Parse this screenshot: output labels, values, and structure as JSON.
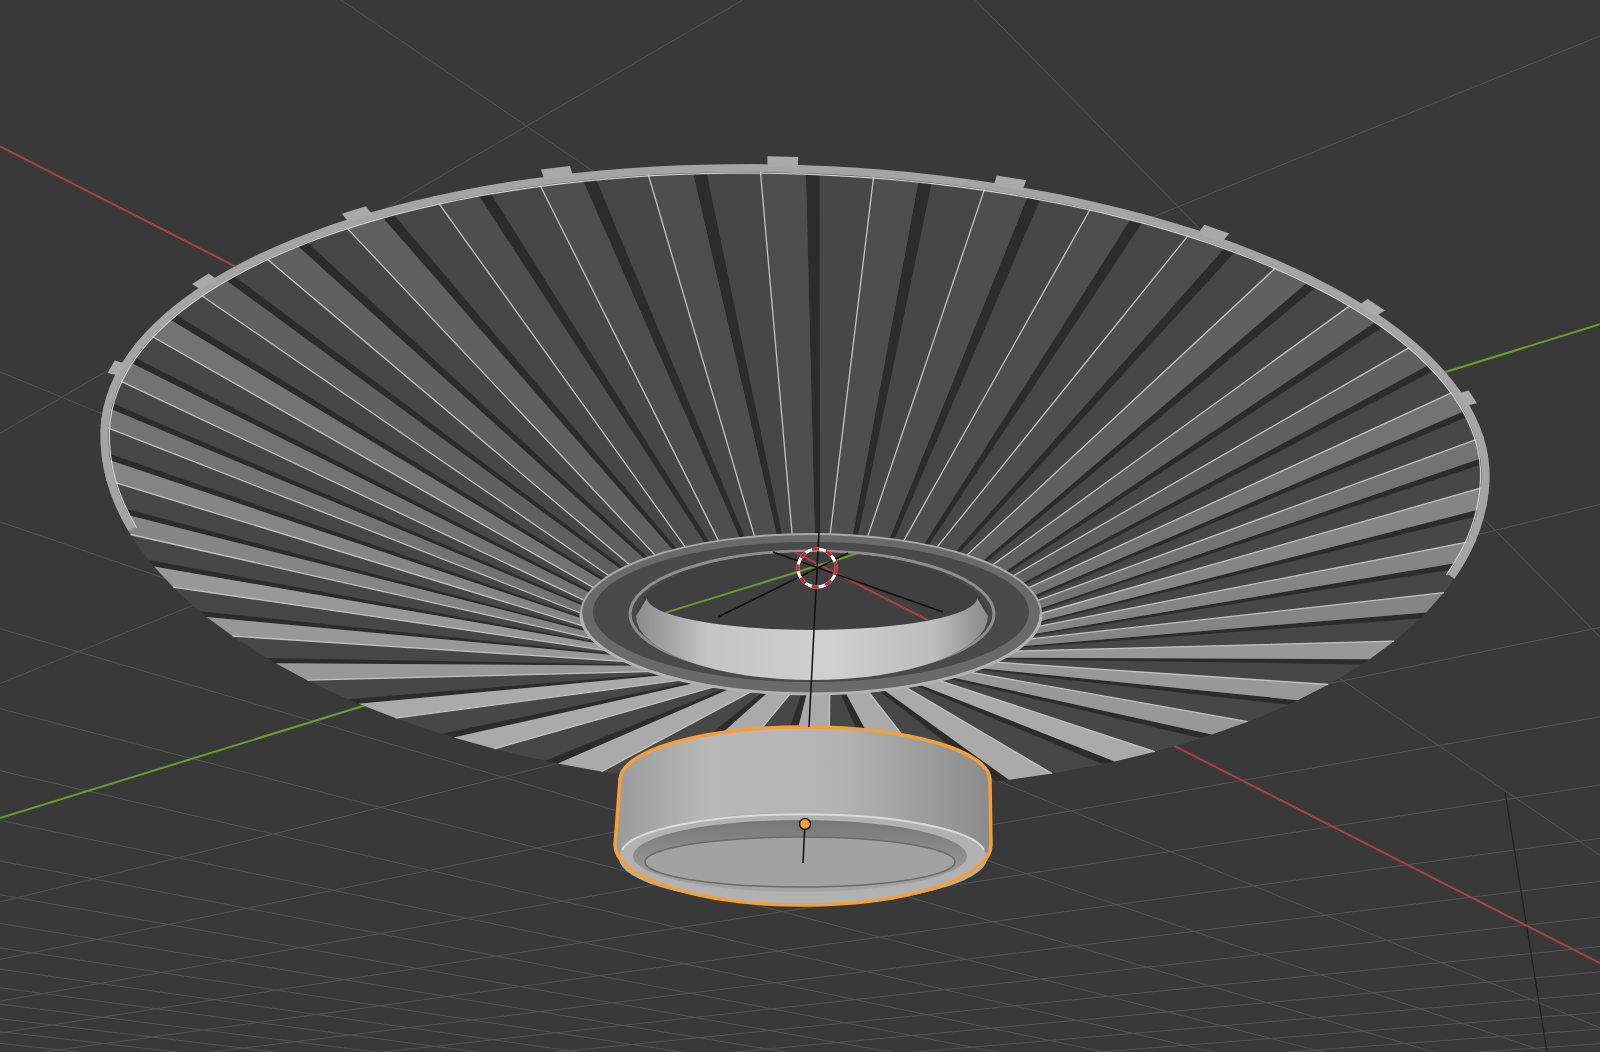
{
  "viewport": {
    "objects": [
      {
        "kind": "shade",
        "selected": false
      },
      {
        "kind": "ring",
        "selected": true
      }
    ]
  }
}
